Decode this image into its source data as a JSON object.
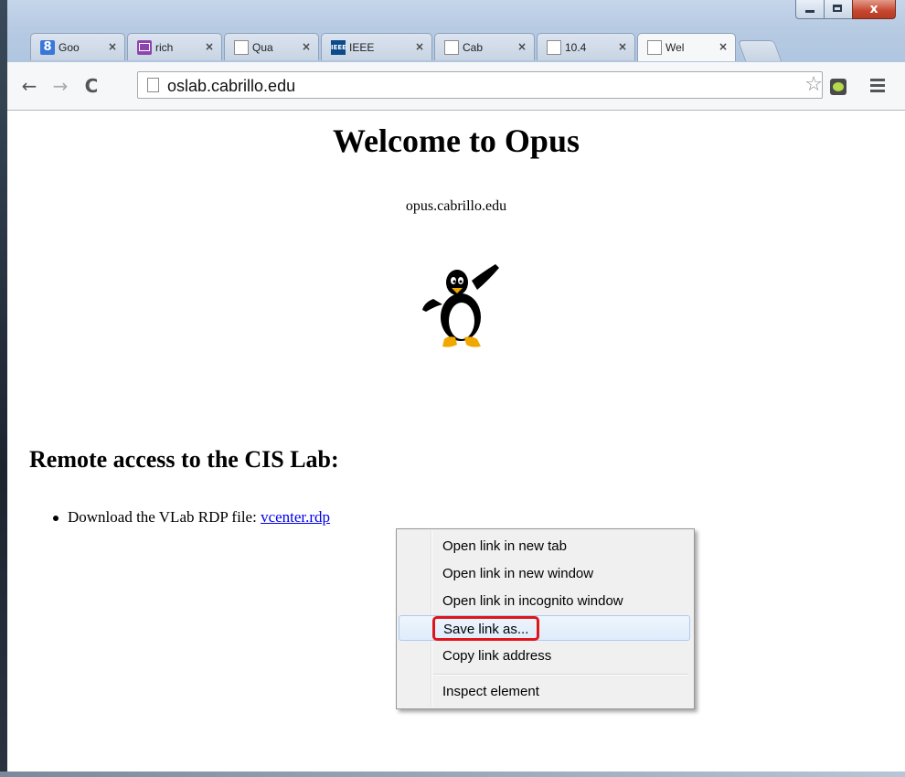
{
  "window": {
    "close_glyph": "x"
  },
  "tabs": [
    {
      "label": "Goo",
      "icon": "google-icon",
      "close": "×"
    },
    {
      "label": "rich",
      "icon": "mail-icon",
      "close": "×"
    },
    {
      "label": "Qua",
      "icon": "page-icon",
      "close": "×"
    },
    {
      "label": "IEEE",
      "icon": "ieee-icon",
      "icon_text": "IEEE",
      "close": "×"
    },
    {
      "label": "Cab",
      "icon": "page-icon",
      "close": "×"
    },
    {
      "label": "10.4",
      "icon": "page-icon",
      "close": "×"
    },
    {
      "label": "Wel",
      "icon": "page-icon",
      "close": "×",
      "active": true
    }
  ],
  "toolbar": {
    "back": "←",
    "forward": "→",
    "reload": "C",
    "url": "oslab.cabrillo.edu",
    "star": "☆"
  },
  "page": {
    "title": "Welcome to Opus",
    "hostname": "opus.cabrillo.edu",
    "section_heading": "Remote access to the CIS Lab:",
    "bullet_text": "Download the VLab RDP file: ",
    "link_text": "vcenter.rdp"
  },
  "context_menu": {
    "items": [
      "Open link in new tab",
      "Open link in new window",
      "Open link in incognito window",
      "Save link as...",
      "Copy link address",
      "Inspect element"
    ],
    "highlighted": "Save link as...",
    "highlight_color": "#e0151a"
  },
  "colors": {
    "link": "#0000ee",
    "menu_bg": "#f0f0f0"
  }
}
